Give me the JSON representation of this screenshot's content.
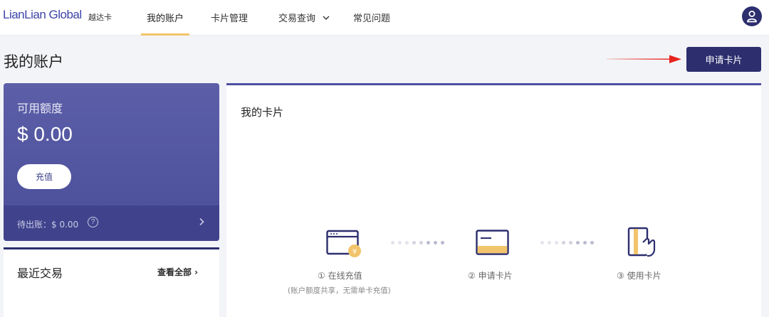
{
  "nav": {
    "logo": "LianLian Global",
    "logo_sub": "越达卡",
    "items": [
      {
        "label": "我的账户",
        "active": true
      },
      {
        "label": "卡片管理",
        "active": false
      },
      {
        "label": "交易查询",
        "active": false
      },
      {
        "label": "常见问题",
        "active": false
      }
    ],
    "avatar_icon": "user-icon"
  },
  "page": {
    "title": "我的账户",
    "apply_button": "申请卡片"
  },
  "balance": {
    "label": "可用额度",
    "amount": "$ 0.00",
    "recharge_button": "充值",
    "pending_text": "待出账：$ 0.00"
  },
  "recent": {
    "title": "最近交易",
    "view_all": "查看全部 ›"
  },
  "cards": {
    "title": "我的卡片",
    "steps": [
      {
        "label": "① 在线充值",
        "sub": "(账户额度共享，无需单卡充值)",
        "icon": "online-recharge-icon"
      },
      {
        "label": "② 申请卡片",
        "sub": "",
        "icon": "card-icon"
      },
      {
        "label": "③ 使用卡片",
        "sub": "",
        "icon": "use-card-icon"
      }
    ]
  },
  "colors": {
    "brand": "#2c2e6e",
    "card_gradient_top": "#5c5fa8",
    "accent_yellow": "#f2c46b",
    "arrow_red": "#e8231e"
  }
}
